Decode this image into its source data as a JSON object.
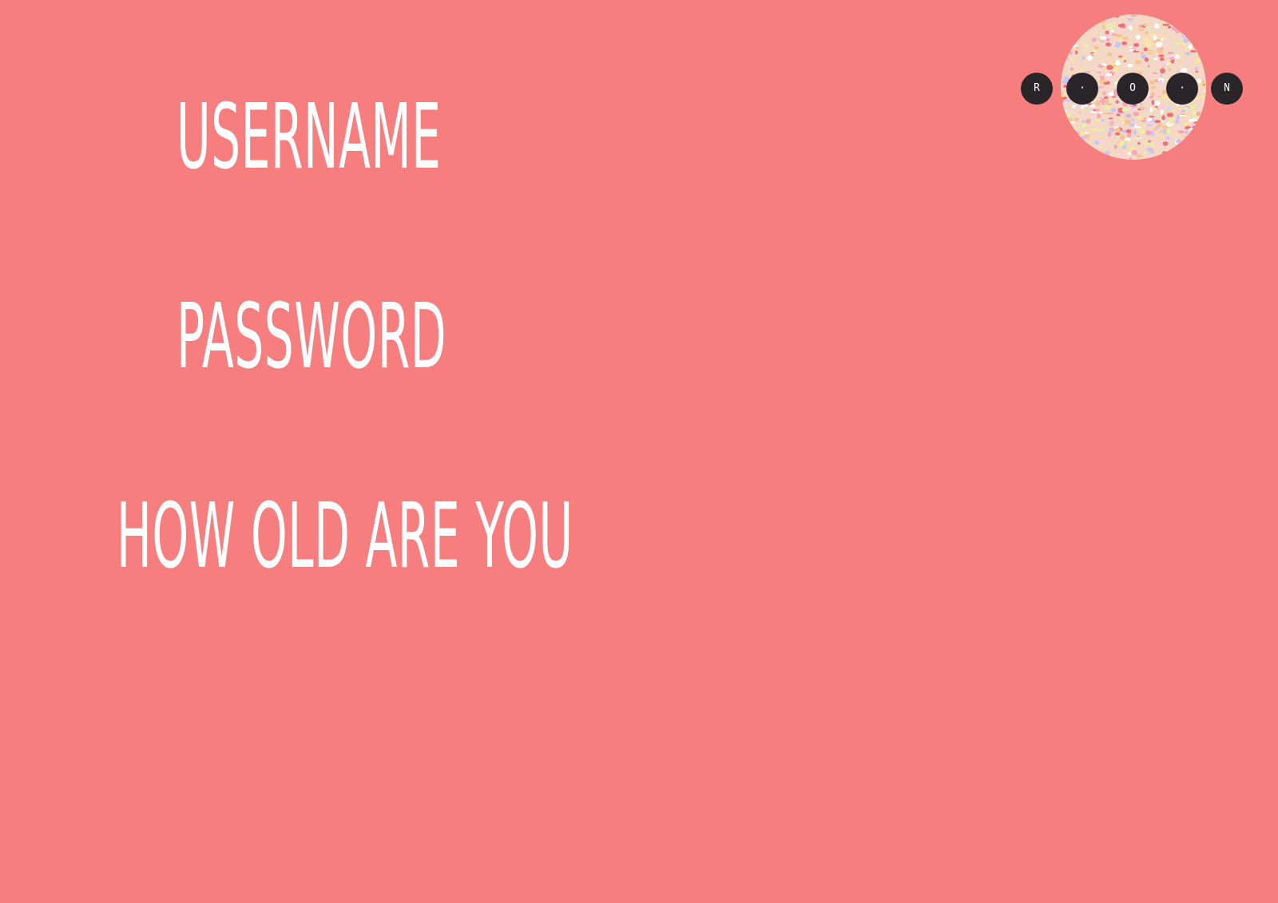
{
  "form": {
    "username_label": "USERNAME",
    "password_label": "PASSWORD",
    "age_label": "HOW OLD ARE YOU"
  },
  "logo": {
    "letters": [
      "R",
      "·",
      "O",
      "·",
      "N"
    ]
  },
  "colors": {
    "background": "#f77e7e",
    "label_text": "#ffffff",
    "logo_dot": "#2a2528"
  }
}
